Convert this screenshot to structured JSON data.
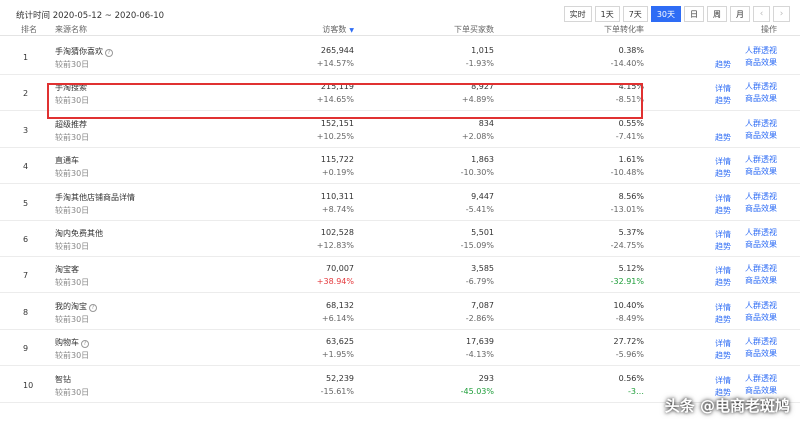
{
  "stat_time": "统计时间 2020-05-12 ~ 2020-06-10",
  "range_buttons": [
    {
      "label": "实时",
      "active": false
    },
    {
      "label": "1天",
      "active": false
    },
    {
      "label": "7天",
      "active": false
    },
    {
      "label": "30天",
      "active": true
    },
    {
      "label": "日",
      "active": false
    },
    {
      "label": "周",
      "active": false
    },
    {
      "label": "月",
      "active": false
    }
  ],
  "nav": {
    "prev": "‹",
    "next": "›"
  },
  "columns": {
    "rank": "排名",
    "source": "来源名称",
    "visits": "访客数",
    "buyers": "下单买家数",
    "rate": "下单转化率",
    "ops": "操作"
  },
  "ops_labels": {
    "detail": "详情",
    "trend": "趋势",
    "crowd": "人群透视",
    "goods": "商品效果"
  },
  "rows": [
    {
      "rank": "1",
      "name": "手淘猜你喜欢",
      "info": true,
      "sub": "较前30日",
      "visits": "265,944",
      "visits_chg": "+14.57%",
      "visits_tone": "",
      "buyers": "1,015",
      "buyers_chg": "-1.93%",
      "buyers_tone": "",
      "rate": "0.38%",
      "rate_chg": "-14.40%",
      "rate_tone": "",
      "detail": false
    },
    {
      "rank": "2",
      "name": "手淘搜索",
      "info": false,
      "sub": "较前30日",
      "visits": "215,119",
      "visits_chg": "+14.65%",
      "visits_tone": "",
      "buyers": "8,927",
      "buyers_chg": "+4.89%",
      "buyers_tone": "",
      "rate": "4.15%",
      "rate_chg": "-8.51%",
      "rate_tone": "",
      "detail": true
    },
    {
      "rank": "3",
      "name": "超级推荐",
      "info": false,
      "sub": "较前30日",
      "visits": "152,151",
      "visits_chg": "+10.25%",
      "visits_tone": "",
      "buyers": "834",
      "buyers_chg": "+2.08%",
      "buyers_tone": "",
      "rate": "0.55%",
      "rate_chg": "-7.41%",
      "rate_tone": "",
      "detail": false
    },
    {
      "rank": "4",
      "name": "直通车",
      "info": false,
      "sub": "较前30日",
      "visits": "115,722",
      "visits_chg": "+0.19%",
      "visits_tone": "",
      "buyers": "1,863",
      "buyers_chg": "-10.30%",
      "buyers_tone": "",
      "rate": "1.61%",
      "rate_chg": "-10.48%",
      "rate_tone": "",
      "detail": true
    },
    {
      "rank": "5",
      "name": "手淘其他店铺商品详情",
      "info": false,
      "sub": "较前30日",
      "visits": "110,311",
      "visits_chg": "+8.74%",
      "visits_tone": "",
      "buyers": "9,447",
      "buyers_chg": "-5.41%",
      "buyers_tone": "",
      "rate": "8.56%",
      "rate_chg": "-13.01%",
      "rate_tone": "",
      "detail": true
    },
    {
      "rank": "6",
      "name": "淘内免费其他",
      "info": false,
      "sub": "较前30日",
      "visits": "102,528",
      "visits_chg": "+12.83%",
      "visits_tone": "",
      "buyers": "5,501",
      "buyers_chg": "-15.09%",
      "buyers_tone": "",
      "rate": "5.37%",
      "rate_chg": "-24.75%",
      "rate_tone": "",
      "detail": true
    },
    {
      "rank": "7",
      "name": "淘宝客",
      "info": false,
      "sub": "较前30日",
      "visits": "70,007",
      "visits_chg": "+38.94%",
      "visits_tone": "up-red",
      "buyers": "3,585",
      "buyers_chg": "-6.79%",
      "buyers_tone": "",
      "rate": "5.12%",
      "rate_chg": "-32.91%",
      "rate_tone": "down-green",
      "detail": true
    },
    {
      "rank": "8",
      "name": "我的淘宝",
      "info": true,
      "sub": "较前30日",
      "visits": "68,132",
      "visits_chg": "+6.14%",
      "visits_tone": "",
      "buyers": "7,087",
      "buyers_chg": "-2.86%",
      "buyers_tone": "",
      "rate": "10.40%",
      "rate_chg": "-8.49%",
      "rate_tone": "",
      "detail": true
    },
    {
      "rank": "9",
      "name": "购物车",
      "info": true,
      "sub": "较前30日",
      "visits": "63,625",
      "visits_chg": "+1.95%",
      "visits_tone": "",
      "buyers": "17,639",
      "buyers_chg": "-4.13%",
      "buyers_tone": "",
      "rate": "27.72%",
      "rate_chg": "-5.96%",
      "rate_tone": "",
      "detail": true
    },
    {
      "rank": "10",
      "name": "智钻",
      "info": false,
      "sub": "较前30日",
      "visits": "52,239",
      "visits_chg": "-15.61%",
      "visits_tone": "",
      "buyers": "293",
      "buyers_chg": "-45.03%",
      "buyers_tone": "down-green",
      "rate": "0.56%",
      "rate_chg": "-3…",
      "rate_tone": "down-green",
      "detail": true
    }
  ],
  "watermark": "头条 @电商老斑鸠",
  "colors": {
    "accent": "#2e6cf5",
    "highlight": "#e03131",
    "increase": "#e4393c",
    "decrease": "#1f9e3a"
  }
}
